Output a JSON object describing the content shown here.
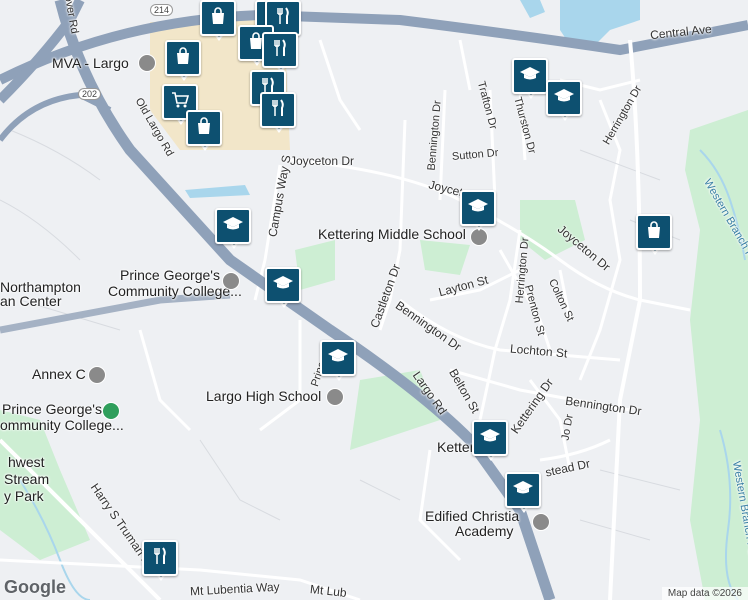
{
  "map": {
    "attribution": "Map data ©2026",
    "logo": "Google",
    "labels": {
      "central_ave": "Central Ave",
      "mva_largo": "MVA - Largo",
      "old_largo_rd": "Old Largo Rd",
      "joyceton_dr_w": "Joyceton Dr",
      "joyceton_dr_mid": "Joyceton Dr",
      "joyceton_dr_e": "Joyceton Dr",
      "campus_way_s": "Campus Way S",
      "kettering_ms": "Kettering Middle School",
      "pgcc_1": "Prince George's",
      "pgcc_2": "Community College...",
      "northampton_1": "Northampton",
      "northampton_2": "an Center",
      "annex_c": "Annex C",
      "pgcc2_1": "Prince George's",
      "pgcc2_2": "ommunity College...",
      "largo_hs": "Largo High School",
      "largo_rd": "Largo Rd",
      "castleton_dr": "Castleton Dr",
      "bennington_dr_1": "Bennington Dr",
      "bennington_dr_2": "Bennington Dr",
      "bennington_dr_3": "Bennington Dr",
      "layton_st": "Layton St",
      "herrington_dr_1": "Herrington Dr",
      "herrington_dr_2": "Herrington Dr",
      "prenton_st": "Prenton St",
      "colton_st": "Colton St",
      "lochton_st": "Lochton St",
      "belton_st": "Belton St",
      "kettering_dr": "Kettering Dr",
      "jo_dr": "Jo Dr",
      "trafton_dr": "Trafton Dr",
      "thurston_dr": "Thurston Dr",
      "sutton_dr": "Sutton Dr",
      "western_branch_1": "Western Branch Patu",
      "western_branch_2": "Western Branch Patux",
      "kettering_town": "Ketter",
      "edified_1": "Edified Christia",
      "edified_2": "Academy",
      "stead_dr": "stead Dr",
      "princ_pl": "Prince Pl",
      "lover_rd": "lover Rd",
      "harry_truman": "Harry S Truman Dr",
      "lubentia": "Mt Lubentia Way",
      "lubentia2": "Mt Lub",
      "nwest_1": "hwest",
      "nwest_2": "Stream",
      "nwest_3": "y Park",
      "route_214": "214",
      "route_202": "202"
    },
    "pins": [
      {
        "kind": "shopping",
        "icon": "shopping-bag-icon"
      },
      {
        "kind": "restaurant",
        "icon": "fork-knife-icon"
      },
      {
        "kind": "restaurant",
        "icon": "fork-knife-icon"
      },
      {
        "kind": "shopping",
        "icon": "shopping-bag-icon"
      },
      {
        "kind": "restaurant",
        "icon": "fork-knife-icon"
      },
      {
        "kind": "shopping",
        "icon": "shopping-bag-icon"
      },
      {
        "kind": "shopping",
        "icon": "shopping-cart-icon"
      },
      {
        "kind": "shopping",
        "icon": "shopping-bag-icon"
      },
      {
        "kind": "restaurant",
        "icon": "fork-knife-icon"
      },
      {
        "kind": "restaurant",
        "icon": "fork-knife-icon"
      },
      {
        "kind": "school",
        "icon": "graduation-cap-icon"
      },
      {
        "kind": "school",
        "icon": "graduation-cap-icon"
      },
      {
        "kind": "school",
        "icon": "graduation-cap-icon"
      },
      {
        "kind": "school",
        "icon": "graduation-cap-icon"
      },
      {
        "kind": "school",
        "icon": "graduation-cap-icon"
      },
      {
        "kind": "shopping",
        "icon": "shopping-bag-icon"
      },
      {
        "kind": "school",
        "icon": "graduation-cap-icon"
      },
      {
        "kind": "school",
        "icon": "graduation-cap-icon"
      },
      {
        "kind": "school",
        "icon": "graduation-cap-icon"
      },
      {
        "kind": "restaurant",
        "icon": "fork-knife-icon"
      }
    ],
    "colors": {
      "pin": "#0d5070",
      "highway": "#8fa1b9",
      "park": "#cdeed3",
      "water": "#a9d6ec",
      "campus": "#f2e6c9"
    }
  }
}
